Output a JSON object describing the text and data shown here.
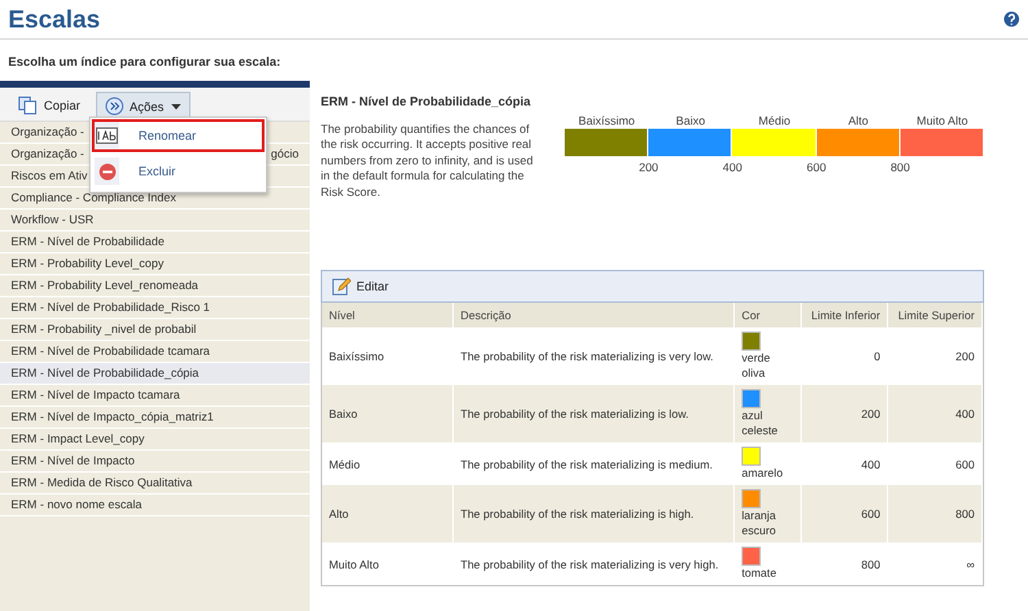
{
  "page": {
    "title": "Escalas",
    "subtitle": "Escolha um índice para configurar sua escala:"
  },
  "toolbar": {
    "buttons": [
      {
        "label": "Copiar",
        "kind": "copy",
        "selected": false
      },
      {
        "label": "Ações",
        "kind": "menu",
        "selected": true
      }
    ]
  },
  "menu": {
    "items": [
      {
        "label": "Renomear",
        "kind": "rename",
        "selected": true
      },
      {
        "label": "Excluir",
        "kind": "delete",
        "selected": false
      }
    ]
  },
  "list": {
    "items": [
      {
        "label": "Organização -",
        "selected": false
      },
      {
        "label": "Organização -",
        "tail": "gócio",
        "selected": false
      },
      {
        "label": "Riscos em Ativ",
        "selected": false
      },
      {
        "label": "Compliance - Compliance Index",
        "selected": false
      },
      {
        "label": "Workflow - USR",
        "selected": false
      },
      {
        "label": "ERM - Nível de Probabilidade",
        "selected": false
      },
      {
        "label": "ERM - Probability Level_copy",
        "selected": false
      },
      {
        "label": "ERM - Probability Level_renomeada",
        "selected": false
      },
      {
        "label": "ERM - Nível de Probabilidade_Risco 1",
        "selected": false
      },
      {
        "label": "ERM - Probability _nivel de probabil",
        "selected": false
      },
      {
        "label": "ERM - Nível de Probabilidade tcamara",
        "selected": false
      },
      {
        "label": "ERM - Nível de Probabilidade_cópia",
        "selected": true
      },
      {
        "label": "ERM - Nível de Impacto tcamara",
        "selected": false
      },
      {
        "label": "ERM - Nível de Impacto_cópia_matriz1",
        "selected": false
      },
      {
        "label": "ERM - Impact Level_copy",
        "selected": false
      },
      {
        "label": "ERM - Nível de Impacto",
        "selected": false
      },
      {
        "label": "ERM - Medida de Risco Qualitativa",
        "selected": false
      },
      {
        "label": "ERM - novo nome escala",
        "selected": false
      }
    ]
  },
  "detail": {
    "title": "ERM - Nível de Probabilidade_cópia",
    "description": "The probability quantifies the chances of the risk occurring. It accepts positive real numbers from zero to infinity, and is used in the default formula for calculating the Risk Score.",
    "scale": {
      "segments": [
        {
          "label": "Baixíssimo",
          "color": "#808000"
        },
        {
          "label": "Baixo",
          "color": "#1e90ff"
        },
        {
          "label": "Médio",
          "color": "#ffff00"
        },
        {
          "label": "Alto",
          "color": "#ff8c00"
        },
        {
          "label": "Muito Alto",
          "color": "#ff6347"
        }
      ],
      "ticks": [
        "200",
        "400",
        "600",
        "800"
      ]
    }
  },
  "table": {
    "edit_button": "Editar",
    "columns": [
      "Nível",
      "Descrição",
      "Cor",
      "Limite Inferior",
      "Limite Superior"
    ],
    "rows": [
      {
        "level": "Baixíssimo",
        "description": "The probability of the risk materializing is very low.",
        "color": "#808000",
        "color_name": "verde oliva",
        "lower": "0",
        "upper": "200"
      },
      {
        "level": "Baixo",
        "description": "The probability of the risk materializing is low.",
        "color": "#1e90ff",
        "color_name": "azul celeste",
        "lower": "200",
        "upper": "400"
      },
      {
        "level": "Médio",
        "description": "The probability of the risk materializing is medium.",
        "color": "#ffff00",
        "color_name": "amarelo",
        "lower": "400",
        "upper": "600"
      },
      {
        "level": "Alto",
        "description": "The probability of the risk materializing is high.",
        "color": "#ff8c00",
        "color_name": "laranja escuro",
        "lower": "600",
        "upper": "800"
      },
      {
        "level": "Muito Alto",
        "description": "The probability of the risk materializing is very high.",
        "color": "#ff6347",
        "color_name": "tomate",
        "lower": "800",
        "upper": "∞"
      }
    ]
  }
}
